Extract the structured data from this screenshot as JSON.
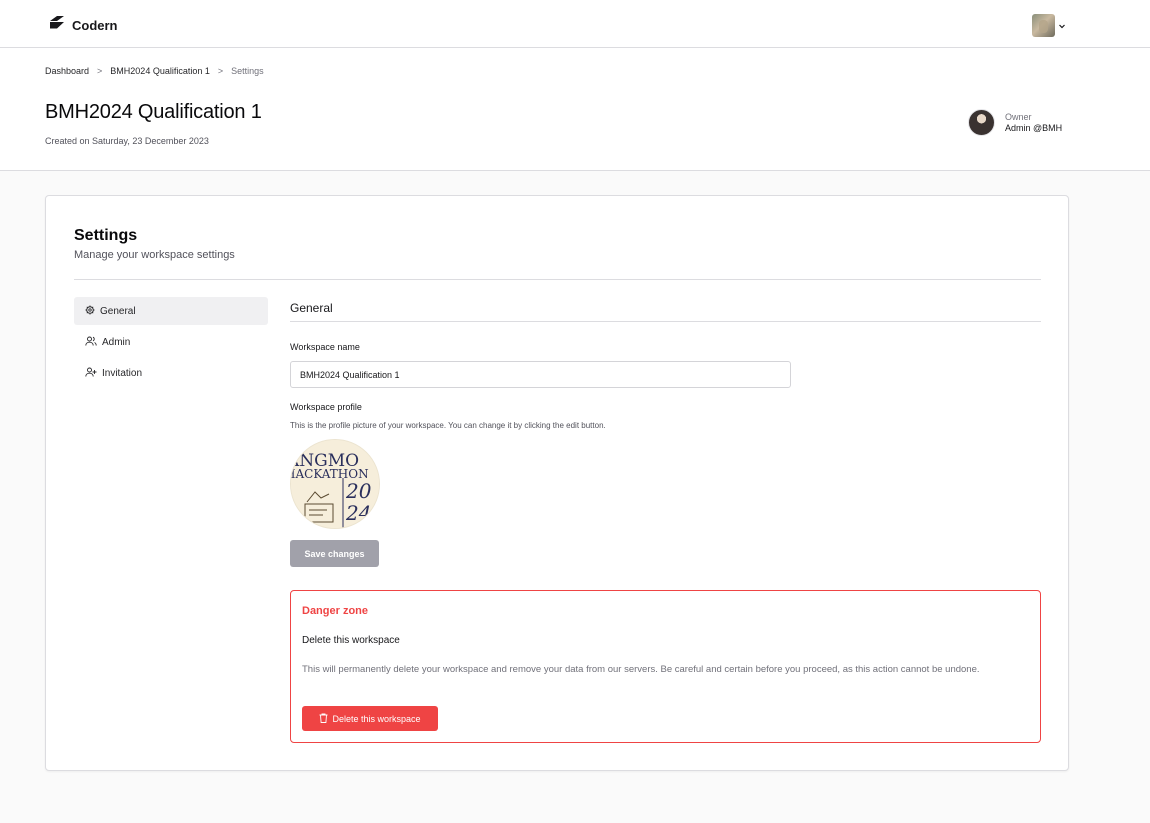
{
  "app": {
    "name": "Codern"
  },
  "breadcrumb": {
    "items": [
      "Dashboard",
      "BMH2024 Qualification 1"
    ],
    "separator": ">",
    "current": "Settings"
  },
  "workspace": {
    "title": "BMH2024 Qualification 1",
    "created": "Created on Saturday, 23 December 2023"
  },
  "owner": {
    "label": "Owner",
    "name": "Admin @BMH"
  },
  "settings": {
    "title": "Settings",
    "subtitle": "Manage your workspace settings",
    "nav": [
      {
        "label": "General",
        "icon": "gear-icon",
        "active": true
      },
      {
        "label": "Admin",
        "icon": "users-icon",
        "active": false
      },
      {
        "label": "Invitation",
        "icon": "user-plus-icon",
        "active": false
      }
    ]
  },
  "general": {
    "section_title": "General",
    "name_label": "Workspace name",
    "name_value": "BMH2024 Qualification 1",
    "profile_label": "Workspace profile",
    "profile_help": "This is the profile picture of your workspace. You can change it by clicking the edit button.",
    "profile_image_text": {
      "line1": "ANGMO",
      "line2": "HACKATHON",
      "year_top": "20",
      "year_bottom": "24"
    },
    "save_label": "Save changes"
  },
  "danger_zone": {
    "title": "Danger zone",
    "heading": "Delete this workspace",
    "description": "This will permanently delete your workspace and remove your data from our servers. Be careful and certain before you proceed, as this action cannot be undone.",
    "button_label": "Delete this workspace"
  },
  "colors": {
    "danger": "#ef4444",
    "disabled": "#a1a1aa",
    "border": "#dcdce0",
    "active_nav": "#f0f0f2"
  }
}
